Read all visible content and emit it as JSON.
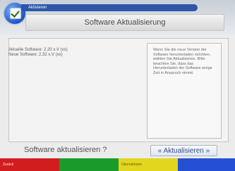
{
  "top": {
    "breadcrumb": "Aktivieren",
    "title": "Software Aktualisierung"
  },
  "info": {
    "current_software": "Aktuelle Software: 2.20 x.V (xx)",
    "new_software": "Neue Software: 2.32 x.V (xx)"
  },
  "help": {
    "text": "Wenn Sie die neue Version der Software herunterladen möchten, wählen Sie Aktualisieren. Bitte beachten Sie, dass das Herunterladen der Software einige Zeit in Anspruch nimmt."
  },
  "prompt": {
    "question": "Software aktualisieren ?",
    "action": "« Aktualisieren »"
  },
  "function_bar": [
    {
      "label": "Zurück",
      "color": "#d11d1d"
    },
    {
      "label": "",
      "color": "#1a9a2b"
    },
    {
      "label": "Übernehmen",
      "color": "#e2d61f"
    },
    {
      "label": "",
      "color": "#2350d4"
    }
  ]
}
